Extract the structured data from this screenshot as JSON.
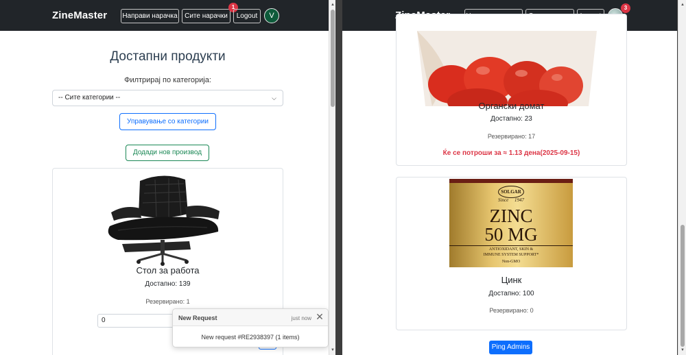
{
  "colors": {
    "navbar": "#212529",
    "primary": "#0d6efd",
    "success": "#198754",
    "danger": "#dc3545",
    "avatar_bg": "#0d5a3a"
  },
  "left": {
    "navbar": {
      "brand": "ZineMaster",
      "buttons": {
        "new_order": "Направи нарачка",
        "all_orders": "Сите нарачки",
        "logout": "Logout"
      },
      "badge_count": "1",
      "avatar_letter": "V"
    },
    "title": "Достапни продукти",
    "filter_label": "Филтрирај по категорија:",
    "category_select": {
      "selected": "-- Сите категории --"
    },
    "manage_categories_label": "Управување со категории",
    "add_product_label": "Додади нов производ",
    "product": {
      "name": "Стол за работа",
      "available": "Достапно: 139",
      "reserved": "Резервирано: 1",
      "quantity_value": "0",
      "image_icon": "office-chair-image"
    },
    "toast": {
      "title": "New Request",
      "time": "just now",
      "message": "New request #RE2938397 (1 items)"
    }
  },
  "right": {
    "navbar": {
      "brand": "ZineMaster",
      "buttons": {
        "new_order": "Направи нарачка",
        "all_orders": "Сите нарачки",
        "logout": "Logout"
      },
      "badge_count": "3"
    },
    "products": [
      {
        "name": "Органски домат",
        "available": "Достапно: 23",
        "reserved": "Резервирано: 17",
        "warning": "Ќе се потроши за ≈ 1.13 дена(2025-09-15)",
        "image_icon": "tomato-bag-image"
      },
      {
        "name": "Цинк",
        "available": "Достапно: 100",
        "reserved": "Резервирано: 0",
        "image_icon": "zinc-bottle-image",
        "label": {
          "brand": "SOLGAR",
          "since": "Since",
          "year": "1947",
          "line1": "ZINC",
          "line2": "50 MG",
          "sub1": "ANTIOXIDANT, SKIN &",
          "sub2": "IMMUNE SYSTEM SUPPORT*",
          "sub3": "Non-GMO"
        }
      }
    ],
    "ping_label": "Ping Admins"
  }
}
